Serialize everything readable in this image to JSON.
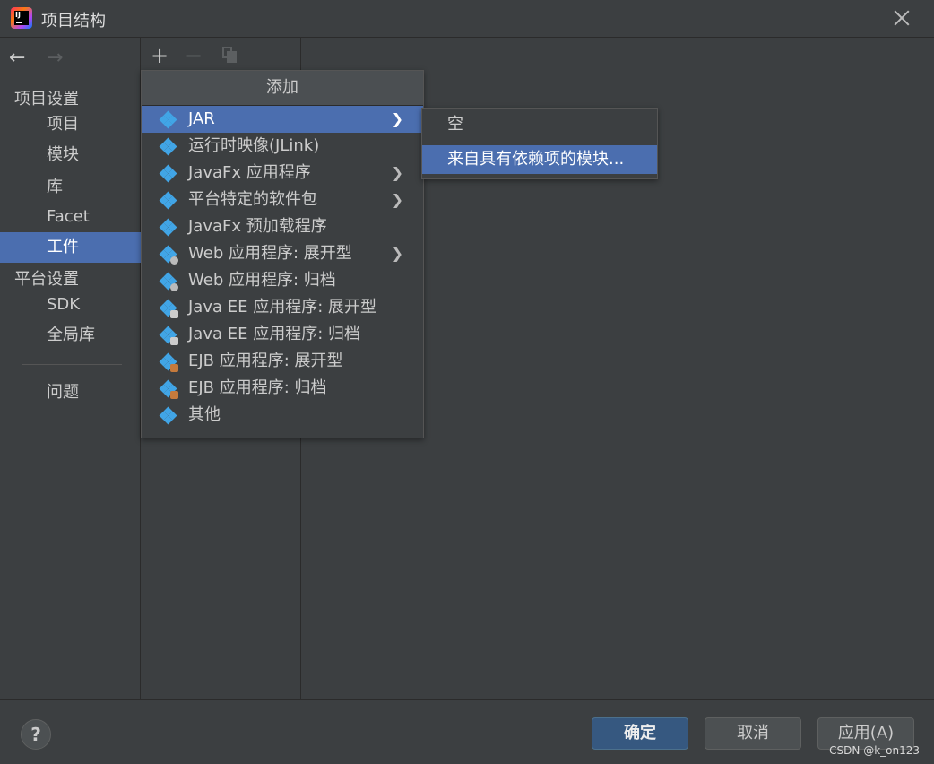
{
  "window": {
    "title": "项目结构"
  },
  "sidebar": {
    "sections": [
      {
        "label": "项目设置"
      },
      {
        "label": "平台设置"
      }
    ],
    "items": [
      {
        "label": "项目"
      },
      {
        "label": "模块"
      },
      {
        "label": "库"
      },
      {
        "label": "Facet"
      },
      {
        "label": "工件",
        "selected": true
      },
      {
        "label": "SDK"
      },
      {
        "label": "全局库"
      },
      {
        "label": "问题"
      }
    ]
  },
  "popup": {
    "header": "添加",
    "items": [
      {
        "label": "JAR",
        "icon": "jar-artifact-icon",
        "submenu": true,
        "selected": true
      },
      {
        "label": "运行时映像(JLink)",
        "icon": "jlink-artifact-icon",
        "submenu": false
      },
      {
        "label": "JavaFx 应用程序",
        "icon": "javafx-artifact-icon",
        "submenu": true
      },
      {
        "label": "平台特定的软件包",
        "icon": "platform-package-icon",
        "submenu": true
      },
      {
        "label": "JavaFx 预加载程序",
        "icon": "javafx-preloader-icon",
        "submenu": false
      },
      {
        "label": "Web 应用程序: 展开型",
        "icon": "web-app-exploded-icon",
        "submenu": true
      },
      {
        "label": "Web 应用程序: 归档",
        "icon": "web-app-archive-icon",
        "submenu": false
      },
      {
        "label": "Java EE 应用程序: 展开型",
        "icon": "javaee-exploded-icon",
        "submenu": false
      },
      {
        "label": "Java EE 应用程序: 归档",
        "icon": "javaee-archive-icon",
        "submenu": false
      },
      {
        "label": "EJB 应用程序: 展开型",
        "icon": "ejb-exploded-icon",
        "submenu": false
      },
      {
        "label": "EJB 应用程序: 归档",
        "icon": "ejb-archive-icon",
        "submenu": false
      },
      {
        "label": "其他",
        "icon": "other-artifact-icon",
        "submenu": false
      }
    ]
  },
  "submenu": {
    "items": [
      {
        "label": "空"
      },
      {
        "label": "来自具有依赖项的模块...",
        "selected": true
      }
    ]
  },
  "toolbar": {
    "add": "+",
    "remove": "−"
  },
  "buttons": {
    "ok": "确定",
    "cancel": "取消",
    "apply": "应用(A)",
    "help": "?"
  },
  "watermark": "CSDN @k_on123",
  "colors": {
    "selection": "#4b6eaf",
    "background": "#3c3f41",
    "primary_button": "#365880"
  }
}
